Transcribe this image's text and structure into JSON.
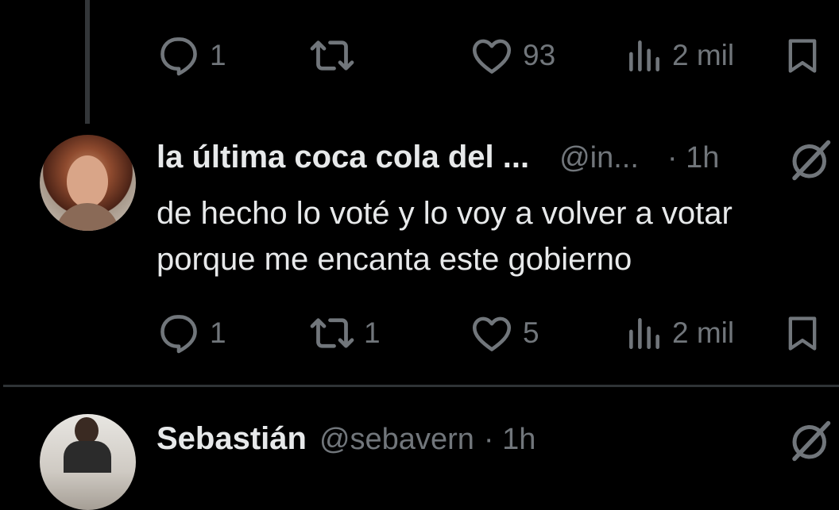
{
  "top_actions": {
    "reply_count": "1",
    "repost_count": "",
    "like_count": "93",
    "views_count": "2 mil"
  },
  "tweet": {
    "display_name": "la última coca cola del ...",
    "handle": "@in...",
    "time": "· 1h",
    "text_line1": "de hecho lo voté y lo voy a volver a votar",
    "text_line2": "porque me encanta este gobierno",
    "reply_count": "1",
    "repost_count": "1",
    "like_count": "5",
    "views_count": "2 mil"
  },
  "next_tweet": {
    "display_name": "Sebastián",
    "handle": "@sebavern",
    "time": "· 1h"
  },
  "icons": [
    "reply-icon",
    "repost-icon",
    "like-icon",
    "views-icon",
    "bookmark-icon",
    "grok-icon"
  ],
  "colors": {
    "background": "#000000",
    "text": "#e7e9ea",
    "muted": "#71767b",
    "divider": "#2f3336"
  }
}
